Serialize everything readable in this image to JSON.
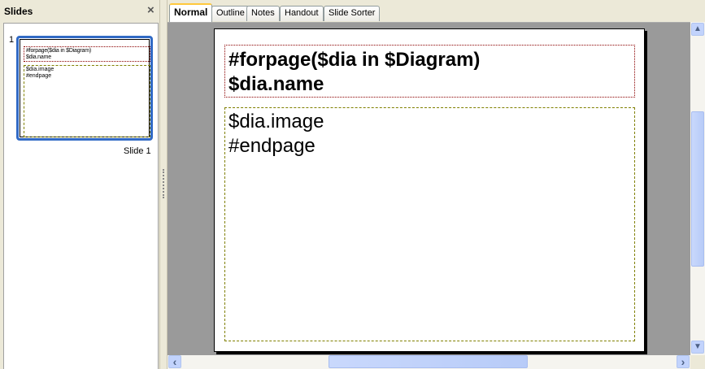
{
  "slides_panel": {
    "title": "Slides",
    "close_icon": "×",
    "slide_number": "1",
    "slide_label": "Slide 1",
    "thumb_title": [
      "#forpage($dia in $Diagram)",
      "$dia.name"
    ],
    "thumb_body": [
      "$dia.image",
      "#endpage"
    ]
  },
  "tabs": [
    {
      "label": "Normal",
      "active": true
    },
    {
      "label": "Outline"
    },
    {
      "label": "Notes"
    },
    {
      "label": "Handout"
    },
    {
      "label": "Slide Sorter"
    }
  ],
  "slide": {
    "title_lines": [
      "#forpage($dia in $Diagram)",
      "$dia.name"
    ],
    "body_lines": [
      "$dia.image",
      "#endpage"
    ]
  },
  "scroll": {
    "up": "▲",
    "down": "▼",
    "left": "‹",
    "right": "›"
  }
}
